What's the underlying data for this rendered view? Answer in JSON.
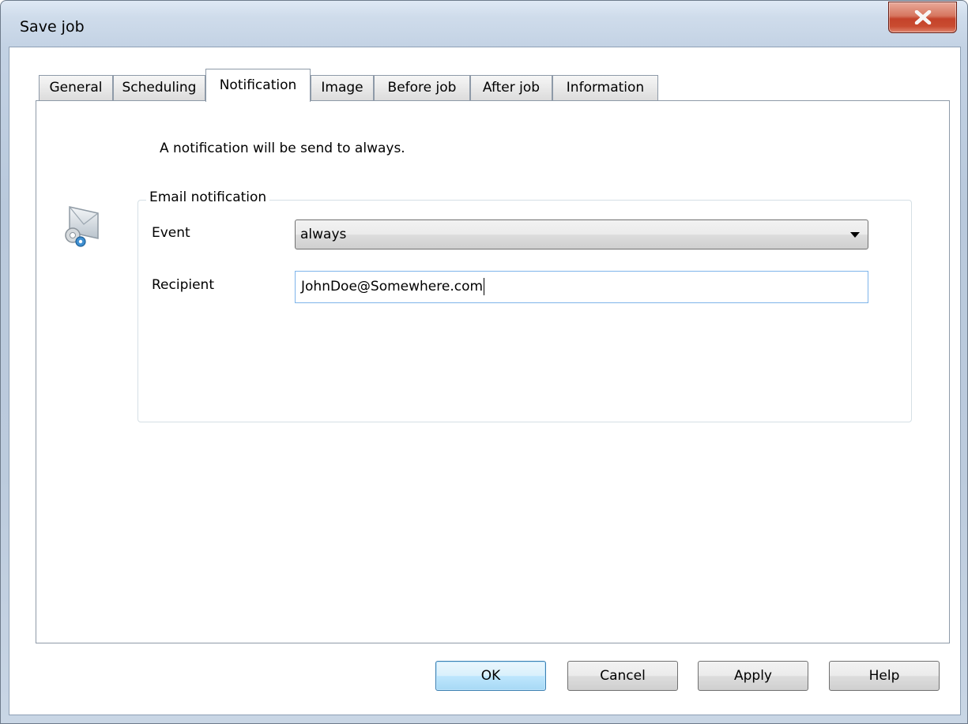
{
  "window": {
    "title": "Save job",
    "close_label": "X"
  },
  "tabs": [
    {
      "label": "General",
      "active": false
    },
    {
      "label": "Scheduling",
      "active": false
    },
    {
      "label": "Notification",
      "active": true
    },
    {
      "label": "Image",
      "active": false
    },
    {
      "label": "Before job",
      "active": false
    },
    {
      "label": "After job",
      "active": false
    },
    {
      "label": "Information",
      "active": false
    }
  ],
  "notification": {
    "info_text": "A notification will be send to always.",
    "icon": "email-settings-icon",
    "group_title": "Email notification",
    "event_label": "Event",
    "event_value": "always",
    "recipient_label": "Recipient",
    "recipient_value": "JohnDoe@Somewhere.com"
  },
  "buttons": {
    "ok": "OK",
    "cancel": "Cancel",
    "apply": "Apply",
    "help": "Help"
  },
  "colors": {
    "close_button": "#c4432a",
    "default_button_border": "#3c7fb1",
    "focused_input_border": "#7eb4ea"
  }
}
